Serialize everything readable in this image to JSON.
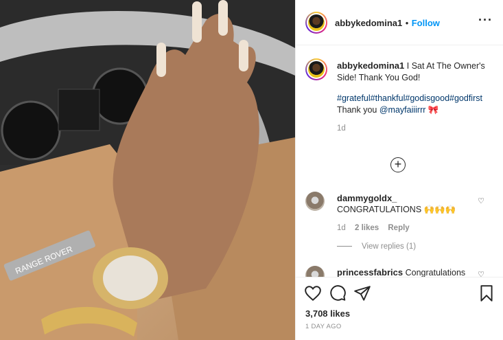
{
  "post": {
    "image_alt": "Hand with long nails and gold watch on Range Rover steering wheel",
    "car_badge_text": "RANGE ROVER"
  },
  "header": {
    "username": "abbykedomina1",
    "separator": "•",
    "follow_label": "Follow",
    "more_icon": "more-options-icon"
  },
  "caption": {
    "username": "abbykedomina1",
    "text": "I Sat At The Owner's Side! Thank You God!",
    "hashtags": "#grateful#thankful#godisgood#godfirst",
    "thanks_prefix": "Thank you",
    "mention": "@mayfaiiirrr",
    "emoji": "🎀",
    "age": "1d"
  },
  "load_more_icon": "plus-circle-icon",
  "comments": [
    {
      "username": "dammygoldx_",
      "text": "CONGRATULATIONS 🙌🙌🙌",
      "age": "1d",
      "likes": "2 likes",
      "reply_label": "Reply",
      "view_replies": "View replies (1)"
    },
    {
      "username": "princessfabrics",
      "text": "Congratulations"
    }
  ],
  "actions": {
    "likes_count": "3,708 likes",
    "time_ago": "1 DAY AGO"
  },
  "colors": {
    "accent": "#0095f6",
    "link": "#00376b",
    "muted": "#8e8e8e"
  }
}
